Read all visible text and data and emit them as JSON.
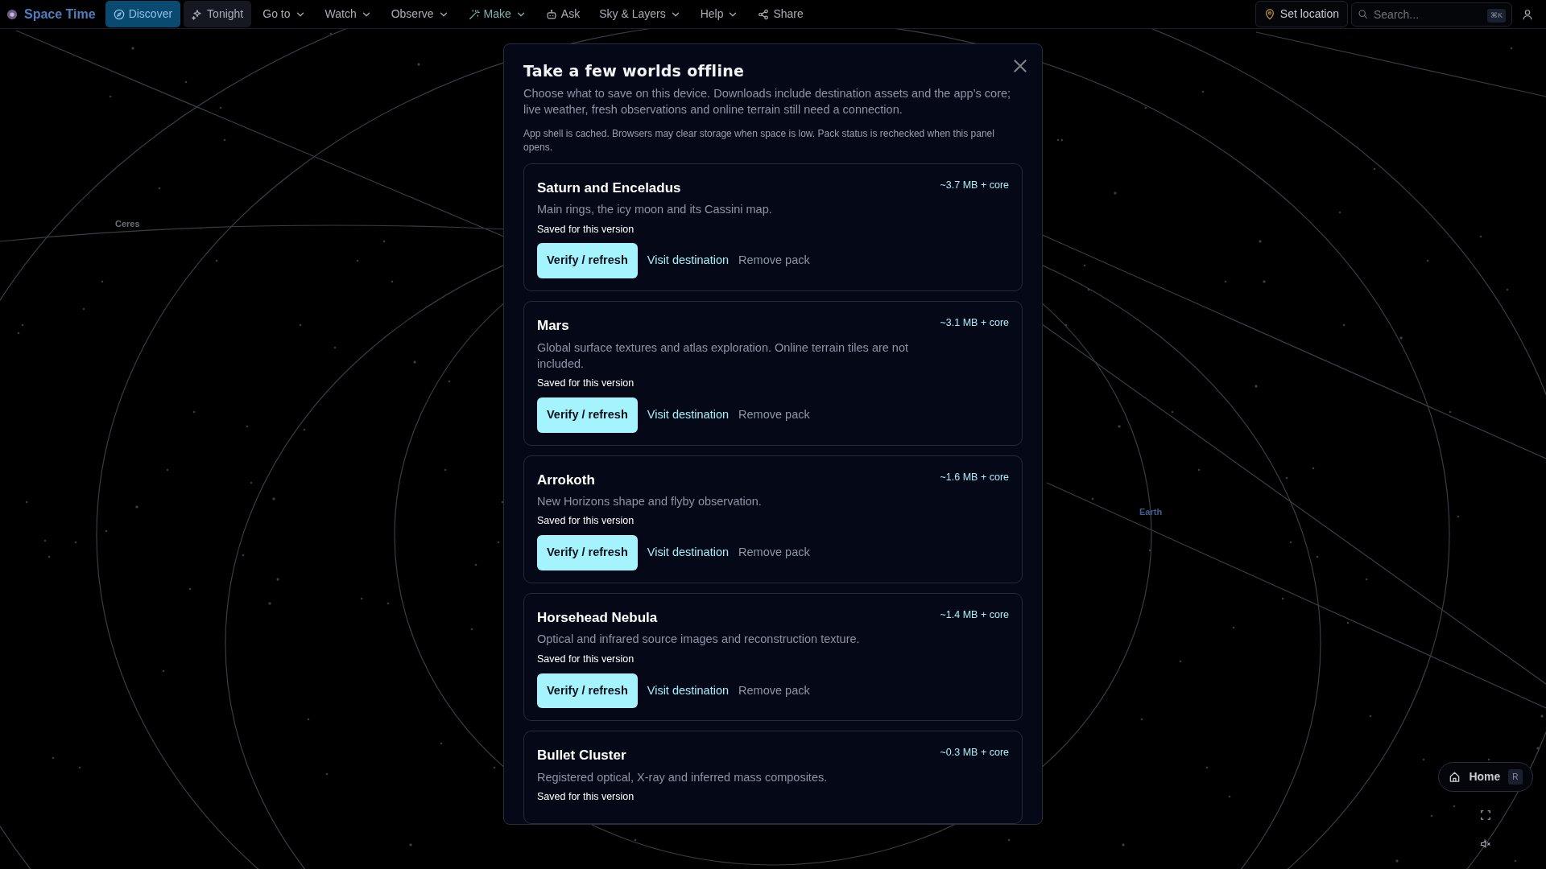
{
  "nav": {
    "brand": "Space Time",
    "items": [
      {
        "label": "Discover",
        "kind": "primary",
        "dropdown": false
      },
      {
        "label": "Tonight",
        "kind": "secondary",
        "dropdown": false
      },
      {
        "label": "Go to",
        "kind": "plain",
        "dropdown": true
      },
      {
        "label": "Watch",
        "kind": "plain",
        "dropdown": true
      },
      {
        "label": "Observe",
        "kind": "plain",
        "dropdown": true
      },
      {
        "label": "Make",
        "kind": "accent",
        "dropdown": true
      },
      {
        "label": "Ask",
        "kind": "plain",
        "dropdown": false
      },
      {
        "label": "Sky & Layers",
        "kind": "plain",
        "dropdown": true
      },
      {
        "label": "Help",
        "kind": "plain",
        "dropdown": true
      },
      {
        "label": "Share",
        "kind": "plain",
        "dropdown": false
      }
    ],
    "location_button": "Set location",
    "search": {
      "placeholder": "Search...",
      "shortcut": "⌘K"
    }
  },
  "scene": {
    "labels": [
      {
        "text": "Ceres",
        "color": "#6b6f78"
      },
      {
        "text": "Earth",
        "color": "#3d5f8f"
      }
    ]
  },
  "dialog": {
    "title": "Take a few worlds offline",
    "intro": "Choose what to save on this device. Downloads include destination assets and the app’s core; live weather, fresh observations and online terrain still need a connection.",
    "note": "App shell is cached. Browsers may clear storage when space is low. Pack status is rechecked when this panel opens.",
    "packs": [
      {
        "name": "Saturn and Enceladus",
        "size": "~3.7 MB + core",
        "description": "Main rings, the icy moon and its Cassini map.",
        "status": "Saved for this version",
        "actions": [
          "Verify / refresh",
          "Visit destination",
          "Remove pack"
        ]
      },
      {
        "name": "Mars",
        "size": "~3.1 MB + core",
        "description": "Global surface textures and atlas exploration. Online terrain tiles are not included.",
        "status": "Saved for this version",
        "actions": [
          "Verify / refresh",
          "Visit destination",
          "Remove pack"
        ]
      },
      {
        "name": "Arrokoth",
        "size": "~1.6 MB + core",
        "description": "New Horizons shape and flyby observation.",
        "status": "Saved for this version",
        "actions": [
          "Verify / refresh",
          "Visit destination",
          "Remove pack"
        ]
      },
      {
        "name": "Horsehead Nebula",
        "size": "~1.4 MB + core",
        "description": "Optical and infrared source images and reconstruction texture.",
        "status": "Saved for this version",
        "actions": [
          "Verify / refresh",
          "Visit destination",
          "Remove pack"
        ]
      },
      {
        "name": "Bullet Cluster",
        "size": "~0.3 MB + core",
        "description": "Registered optical, X-ray and inferred mass composites.",
        "status": "Saved for this version"
      }
    ]
  },
  "home_button": {
    "label": "Home",
    "shortcut": "R"
  }
}
